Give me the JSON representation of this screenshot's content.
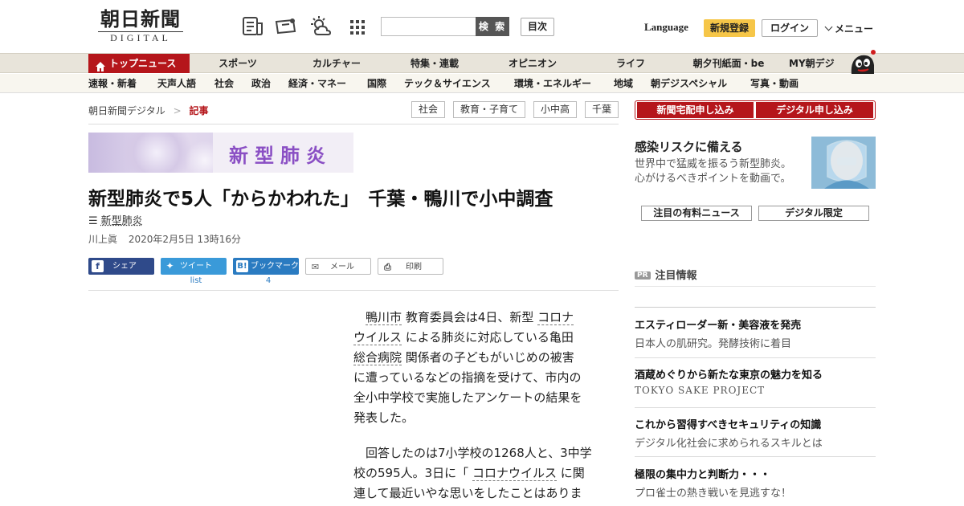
{
  "header": {
    "logo_main": "朝日新聞",
    "logo_sub": "DIGITAL",
    "search_button": "検 索",
    "mokuji": "目次",
    "language": "Language",
    "signup": "新規登録",
    "login": "ログイン",
    "menu": "メニュー"
  },
  "nav_primary": {
    "top": "トップニュース",
    "items": [
      "スポーツ",
      "カルチャー",
      "特集・連載",
      "オピニオン",
      "ライフ",
      "朝夕刊紙面・be",
      "MY朝デジ"
    ]
  },
  "nav_secondary": {
    "items": [
      "速報・新着",
      "天声人語",
      "社会",
      "政治",
      "経済・マネー",
      "国際",
      "テック＆サイエンス",
      "環境・エネルギー",
      "地域",
      "朝デジスペシャル",
      "写真・動画"
    ]
  },
  "breadcrumb": {
    "home": "朝日新聞デジタル",
    "sep": ">",
    "current": "記事"
  },
  "tags": [
    "社会",
    "教育・子育て",
    "小中高",
    "千葉"
  ],
  "article": {
    "banner_text": "新型肺炎",
    "headline": "新型肺炎で5人「からかわれた」　千葉・鴨川で小中調査",
    "topic": "新型肺炎",
    "author": "川上眞",
    "date": "2020年2月5日 13時16分",
    "share": {
      "facebook": "シェア",
      "twitter": "ツイート",
      "twitter_count": "list",
      "hatena": "ブックマーク",
      "hatena_count": "4",
      "mail": "メール",
      "print": "印刷"
    },
    "p1": {
      "kw1": "鴨川市",
      "t1": "教育委員会は4日、新型",
      "kw2a": "コロナ",
      "kw2b": "ウイルス",
      "t2": "による肺炎に対応している亀田",
      "kw3": "総合病院",
      "t3": "関係者の子どもがいじめの被害",
      "t4": "に遭っているなどの指摘を受けて、市内の",
      "t5": "全小中学校で実施したアンケートの結果を",
      "t6": "発表した。"
    },
    "p2": {
      "t1": "回答したのは7小学校の1268人と、3中学",
      "t2a": "校の595人。3日に「",
      "kw1": "コロナウイルス",
      "t2b": "に関",
      "t3": "連して最近いやな思いをしたことはありま"
    }
  },
  "sidebar": {
    "subscribe_paper": "新聞宅配申し込み",
    "subscribe_digital": "デジタル申し込み",
    "feature_title": "感染リスクに備える",
    "feature_desc1": "世界中で猛威を振るう新型肺炎。",
    "feature_desc2": "心がけるべきポイントを動画で。",
    "tab1": "注目の有料ニュース",
    "tab2": "デジタル限定",
    "pr_badge": "PR",
    "pr_label": "注目情報",
    "ads": [
      {
        "title": "エスティローダー新・美容液を発売",
        "sub": "日本人の肌研究。発酵技術に着目"
      },
      {
        "title": "酒蔵めぐりから新たな東京の魅力を知る",
        "sub": "TOKYO SAKE PROJECT"
      },
      {
        "title": "これから習得すべきセキュリティの知識",
        "sub": "デジタル化社会に求められるスキルとは"
      },
      {
        "title": "極限の集中力と判断力・・・",
        "sub": "プロ雀士の熱き戦いを見逃すな！"
      }
    ]
  },
  "colors": {
    "brand_red": "#b5161b",
    "signup_yellow": "#f6c648",
    "facebook": "#2f4a8a",
    "twitter": "#3a9ad9",
    "hatena": "#2a7bc1"
  }
}
